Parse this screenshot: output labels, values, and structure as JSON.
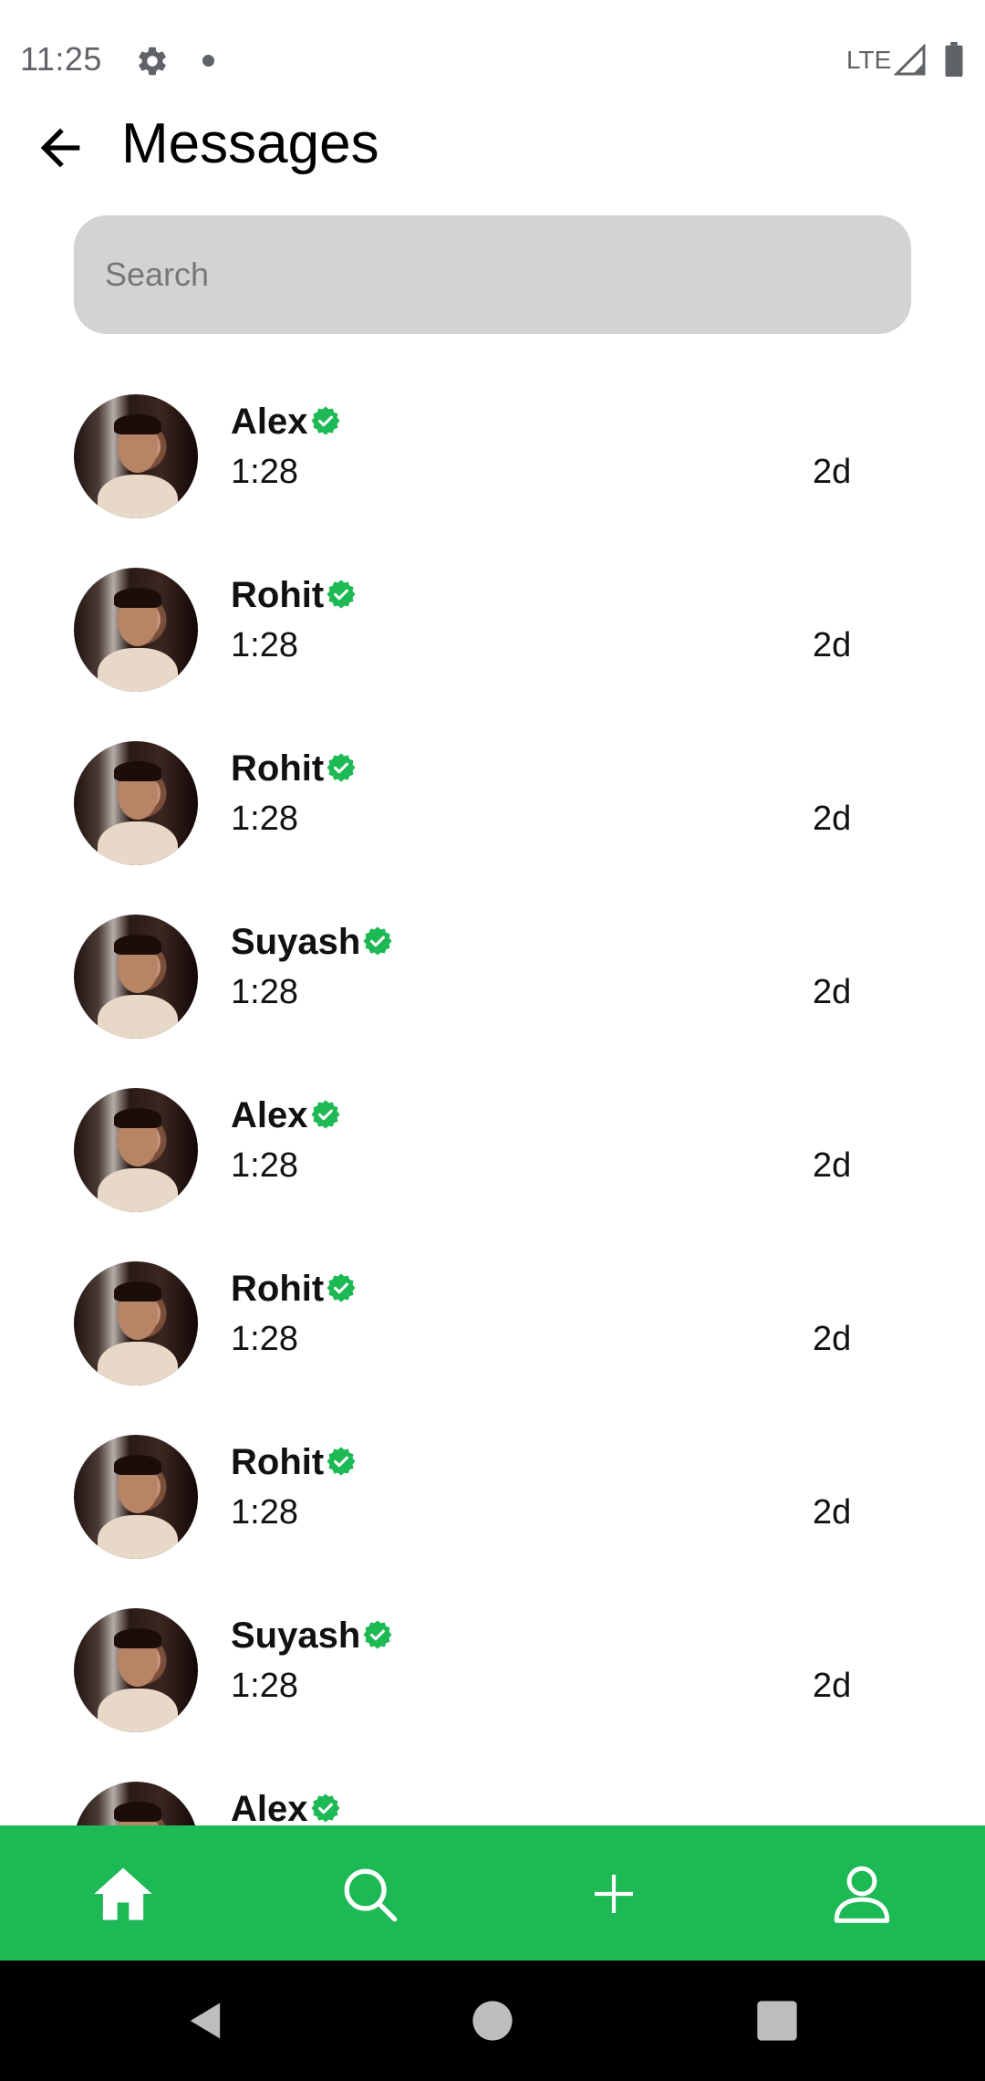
{
  "status_bar": {
    "time": "11:25",
    "network": "LTE",
    "icons": [
      "gear-icon",
      "notification-dot-icon",
      "signal-icon",
      "battery-icon"
    ]
  },
  "header": {
    "title": "Messages",
    "back_icon": "arrow-left-icon"
  },
  "search": {
    "placeholder": "Search",
    "value": ""
  },
  "conversations": [
    {
      "name": "Alex",
      "preview": "1:28",
      "time": "2d"
    },
    {
      "name": "Rohit",
      "preview": "1:28",
      "time": "2d"
    },
    {
      "name": "Rohit",
      "preview": "1:28",
      "time": "2d"
    },
    {
      "name": "Suyash",
      "preview": "1:28",
      "time": "2d"
    },
    {
      "name": "Alex",
      "preview": "1:28",
      "time": "2d"
    },
    {
      "name": "Rohit",
      "preview": "1:28",
      "time": "2d"
    },
    {
      "name": "Rohit",
      "preview": "1:28",
      "time": "2d"
    },
    {
      "name": "Suyash",
      "preview": "1:28",
      "time": "2d"
    },
    {
      "name": "Alex",
      "preview": "",
      "time": ""
    }
  ],
  "bottom_nav": {
    "items": [
      "home-icon",
      "search-icon",
      "plus-icon",
      "profile-icon"
    ],
    "background": "#1db954"
  },
  "colors": {
    "accent": "#1db954",
    "verified": "#1db954",
    "search_bg": "#d3d3d3"
  }
}
